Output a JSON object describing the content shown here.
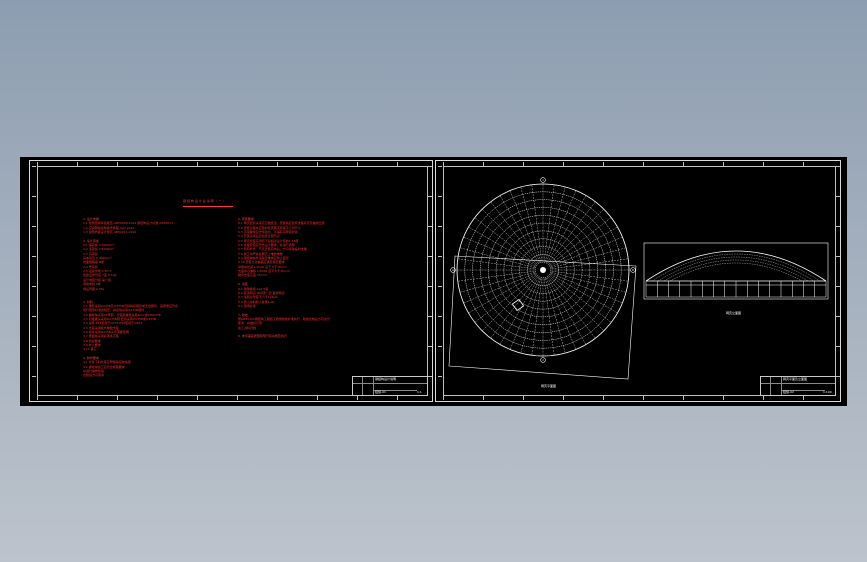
{
  "drawing": {
    "left_sheet": {
      "notes_title": "钢 结 构 设 计 总 说 明 （ 一 ）",
      "notes_left": [
        {
          "text": "1. 设计依据",
          "heading": true
        },
        {
          "text": "  1.1 建筑结构荷载规范 GB50009-2012 钢结构设计标准 GB50017 ...",
          "heading": false
        },
        {
          "text": "  1.2 空间网格结构技术规程 JGJ7-2010",
          "heading": false
        },
        {
          "text": "  1.3 建筑抗震设计规范 GB50011-2010",
          "heading": false
        },
        {
          "text": "",
          "heading": false
        },
        {
          "text": "2. 设计荷载",
          "heading": true
        },
        {
          "text": "  2.1 恒荷载 0.50kN/m²",
          "heading": false
        },
        {
          "text": "  2.2 活荷载 0.50kN/m²",
          "heading": false
        },
        {
          "text": "  2.3 风荷载",
          "heading": false
        },
        {
          "text": "     基本风压 0.45kN/m²",
          "heading": false
        },
        {
          "text": "     地面粗糙度 B类",
          "heading": false
        },
        {
          "text": "  2.4 雪荷载",
          "heading": false
        },
        {
          "text": "  2.5 温度作用 ±30°C",
          "heading": false
        },
        {
          "text": "     抗震设防烈度 7度 0.10g",
          "heading": false
        },
        {
          "text": "     设计地震分组 第一组",
          "heading": false
        },
        {
          "text": "     场地类别 II类",
          "heading": false
        },
        {
          "text": "     特征周期 0.35s",
          "heading": false
        },
        {
          "text": "",
          "heading": false
        },
        {
          "text": "",
          "heading": false
        },
        {
          "text": "3. 材料",
          "heading": true
        },
        {
          "text": "  3.1 钢管采用Q235B及Q355B高频焊接钢管或无缝钢管，其质量应符合",
          "heading": false
        },
        {
          "text": "     现行国家标准的规定，焊接球采用Q235B钢材",
          "heading": false
        },
        {
          "text": "  3.2 螺栓球采用45号钢，高强度螺栓采用40Cr或20MnTiB",
          "heading": false
        },
        {
          "text": "  3.3 封板锥头采用Q235B钢 套筒采用Q235B或Q355B",
          "heading": false
        },
        {
          "text": "  3.4 焊条 E43型用于Q235 E50型用于Q355",
          "heading": false
        },
        {
          "text": "  3.5 支座采用板式橡胶支座",
          "heading": false
        },
        {
          "text": "  3.6 檩条采用Q235B冷弯薄壁型钢",
          "heading": false
        },
        {
          "text": "  3.7 屋面板采用彩钢夹芯板",
          "heading": false
        },
        {
          "text": "  3.8 防腐要求",
          "heading": false
        },
        {
          "text": "  3.9 防火要求",
          "heading": false
        },
        {
          "text": "  3.10 其它",
          "heading": false
        },
        {
          "text": "",
          "heading": false
        },
        {
          "text": "4. 制作要求",
          "heading": true
        },
        {
          "text": "  4.1 杆件下料长度应预留焊接收缩量",
          "heading": false
        },
        {
          "text": "  4.2 螺栓球加工应符合规程要求",
          "heading": false
        },
        {
          "text": "     并进行抽样检验",
          "heading": false
        },
        {
          "text": "     合格后方可使用",
          "heading": false
        }
      ],
      "notes_right": [
        {
          "text": "5. 安装要求",
          "heading": true
        },
        {
          "text": "  5.1 网壳安装采用高空散装法，安装前应复核支座标高及轴线位置",
          "heading": false
        },
        {
          "text": "  5.2 安装过程中应随时检查网壳挠度及几何尺寸",
          "heading": false
        },
        {
          "text": "  5.3 高强螺栓应拧紧到位，不得有间隙和松动",
          "heading": false
        },
        {
          "text": "  5.4 安装完成后应检查全部节点",
          "heading": false
        },
        {
          "text": "  5.5 网壳挠度实测值不应超过设计值的1.15倍",
          "heading": false
        },
        {
          "text": "  5.6 支座安装应符合设计要求，并进行调整",
          "heading": false
        },
        {
          "text": "  5.7 所有杆件、节点安装完毕后，方可拆除临时支撑",
          "heading": false
        },
        {
          "text": "  5.8 施工中严禁在网壳上堆放重物",
          "heading": false
        },
        {
          "text": "  5.9 钢结构构件运输及堆放应防止变形",
          "heading": false
        },
        {
          "text": "  5.10 安装允许偏差应满足规范要求",
          "heading": false
        },
        {
          "text": "     纵横向长度 L/2000 且不大于30mm",
          "heading": false
        },
        {
          "text": "     支座中心偏移 L/3000 且不大于30mm",
          "heading": false
        },
        {
          "text": "     相邻支座高差 15mm",
          "heading": false
        },
        {
          "text": "",
          "heading": false
        },
        {
          "text": "6. 涂装",
          "heading": true
        },
        {
          "text": "  6.1 除锈等级 Sa2.5级",
          "heading": false
        },
        {
          "text": "  6.2 底漆两道 中间漆一道 面漆两道",
          "heading": false
        },
        {
          "text": "  6.3 漆膜总厚度不小于125μm",
          "heading": false
        },
        {
          "text": "  6.4 防火涂料耐火极限1.0h",
          "heading": false
        },
        {
          "text": "  6.5 现场补漆",
          "heading": false
        },
        {
          "text": "",
          "heading": false
        },
        {
          "text": "7. 验收",
          "heading": true
        },
        {
          "text": "     按GB50205钢结构工程施工质量验收标准执行，验收合格后方可交付",
          "heading": false
        },
        {
          "text": "     使用，并做好记录",
          "heading": false
        },
        {
          "text": "     竣工资料归档",
          "heading": false
        },
        {
          "text": "",
          "heading": false
        },
        {
          "text": "8. 未尽事宜按国家现行有关规范执行",
          "heading": true
        }
      ],
      "title_block": {
        "name": "钢结构设计说明",
        "sheet_no": "结施-01",
        "scale": "1:1"
      }
    },
    "right_sheet": {
      "plan_label": "网壳平面图",
      "elevation_label": "网壳立面图",
      "axis_markers": [
        "1",
        "2",
        "A",
        "B"
      ],
      "title_block": {
        "name": "网壳平面及立面图",
        "sheet_no": "结施-02",
        "scale": "1:100"
      }
    },
    "colors": {
      "canvas": "#000000",
      "frame": "#d9d9d9",
      "notes_text": "#ff2a2a",
      "geometry": "#ffffff",
      "background_top": "#8d9db1",
      "background_bottom": "#bcc3cc"
    }
  }
}
